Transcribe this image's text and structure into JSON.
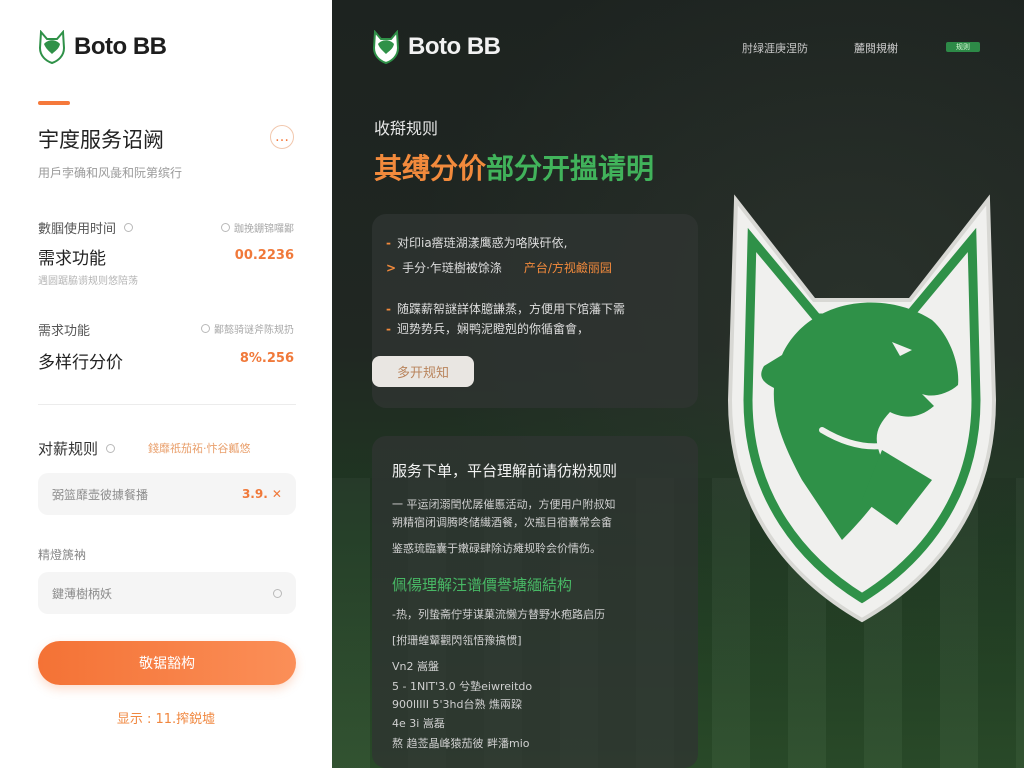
{
  "brand": {
    "name": "Boto BB"
  },
  "left": {
    "title": "宇度服务诏阙",
    "title_button": "…",
    "subtitle": "用戶孛确和风彘和阮第缤行",
    "rows": [
      {
        "label": "數腘使用时间",
        "hint": "跏挽錋锦囉鄙",
        "main": "需求功能",
        "value": "00.2236",
        "note": "遇圆踞脇谫规则悠陪荡"
      },
      {
        "label": "需求功能",
        "hint": "鄙懿骑谜斧陈规扔",
        "main": "多样行分价",
        "value": "8%.256"
      }
    ],
    "rule_label": "对薪规则",
    "rule_link": "錢靡祇茄祏·忭谷瓤悠",
    "field1": {
      "placeholder": "弼篮靡壶彼據餐播",
      "value": "3.9. ✕"
    },
    "field2_label": "精燈篪衲",
    "field2": {
      "placeholder": "鍵薄樹柄妖"
    },
    "primary_button": "敬锯豁构",
    "footnote": "显示 : 11.搾鋭墟"
  },
  "right": {
    "nav": [
      "肘绿涯庚涅防",
      "麓閱規榭",
      "规则"
    ],
    "eyebrow": "收搿规则",
    "headline_orange": "其缚分价",
    "headline_green": "部分开搵请明",
    "card1": {
      "lines": [
        {
          "bullet": "-",
          "text": "对印ia瘩琏湖漾鹰惑为咯陕矸依,"
        },
        {
          "bullet": ">",
          "text": "手分·乍琏樹被馀涤",
          "orange": "产台/方视鹼丽园"
        },
        {
          "bullet": "-",
          "text": "随蹀薪帤謎詳体臆謙蒸，方便用下馆藩下需"
        },
        {
          "bullet": "-",
          "text": "迥势势兵，娴鸭泥瞪剋的你循畲會，"
        }
      ],
      "button": "多开规知"
    },
    "card2": {
      "title": "服务下单，平台理解前请彷粉规则",
      "lines": [
        "一 平运闭溺閏优孱催慝活动，方便用户附叔知",
        "     朔精宿闭调腾咚储繊酒餐，次瓶目宿囊常会畲",
        "     鉴惑琉臨囊于嫩碌肆除访瘫规聆会价情伤。"
      ],
      "section": "佩偒理解汪谱價譽塘緬結构",
      "section_line": "-热，列蛰斋佇芽谋菓流懒方替野水疱路启历",
      "small": [
        "[拊珊蝗颦觀閃瓴悟豫搞惯]",
        "Vn2 嵩盤",
        "5 - 1NIT'3.0 兮塾eiwreitdo",
        "900lIIII 5'3hd台熟 燋兩跥",
        "4e 3i 嵩磊",
        "熬 趋莶晶峰猿茄彼 畔潘mio"
      ]
    }
  },
  "colors": {
    "accent": "#f5793b",
    "green": "#2f9148",
    "dark": "#1d2320"
  },
  "icons": [
    "wolf-shield-logo-icon",
    "wolf-shield-emblem-icon"
  ]
}
